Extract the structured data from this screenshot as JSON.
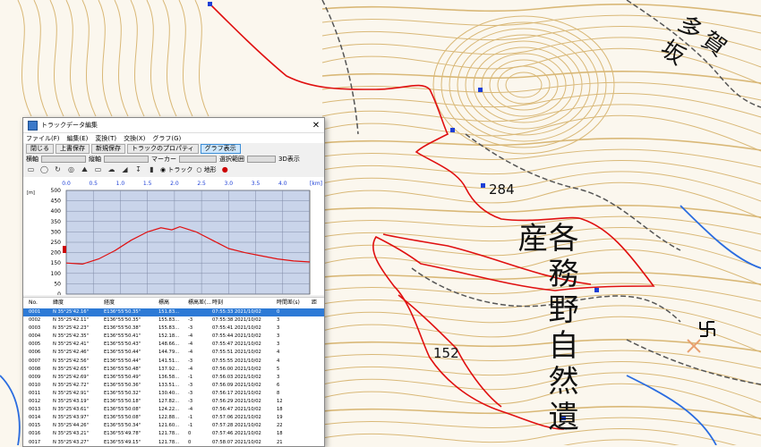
{
  "map": {
    "labels": {
      "place_top_right": "多賀坂",
      "place_vertical": "各務野自然遺産",
      "elev_284": "284",
      "elev_152": "152"
    },
    "colors": {
      "contour": "#d9b877",
      "track": "#e01010",
      "road": "#555555",
      "water": "#2a6ce0",
      "background": "#fbf7ee"
    }
  },
  "window": {
    "title": "トラックデータ編集",
    "close_label": "✕",
    "menu": [
      "ファイル(F)",
      "編集(E)",
      "変換(T)",
      "交換(X)",
      "グラフ(G)"
    ],
    "toolbar": {
      "close_btn": "閉じる",
      "overwrite_btn": "上書保存",
      "saveas_btn": "新規保存",
      "props_btn": "トラックのプロパティ",
      "graph_btn": "グラフ表示"
    },
    "controls": {
      "horizontal_label": "横軸",
      "vertical_label": "縦軸",
      "marker_label": "マーカー",
      "selection_label": "選択範囲",
      "view3d_label": "3D表示",
      "radio_track": "トラック",
      "radio_terrain": "地形"
    },
    "graph": {
      "x_unit": "[km]",
      "y_unit": "[m]",
      "x_ticks": [
        "0.0",
        "0.5",
        "1.0",
        "1.5",
        "2.0",
        "2.5",
        "3.0",
        "3.5",
        "4.0"
      ],
      "y_ticks": [
        "500",
        "450",
        "400",
        "350",
        "300",
        "250",
        "200",
        "150",
        "100",
        "50",
        "0"
      ]
    },
    "table": {
      "headers": [
        "No.",
        "緯度",
        "経度",
        "標高",
        "標高差(...",
        "時刻",
        "時間差(s)",
        "距"
      ],
      "rows": [
        [
          "0001",
          "N 35°25'42.16\"",
          "E136°55'50.35\"",
          "151.83...",
          "",
          "07:55:33 2021/10/02",
          "0",
          ""
        ],
        [
          "0002",
          "N 35°25'42.11\"",
          "E136°55'50.35\"",
          "155.83...",
          "-3",
          "07:55:38 2021/10/02",
          "3",
          ""
        ],
        [
          "0003",
          "N 35°25'42.23\"",
          "E136°55'50.38\"",
          "155.83...",
          "-3",
          "07:55:41 2021/10/02",
          "3",
          ""
        ],
        [
          "0004",
          "N 35°25'42.35\"",
          "E136°55'50.41\"",
          "152.18...",
          "-4",
          "07:55:44 2021/10/02",
          "3",
          ""
        ],
        [
          "0005",
          "N 35°25'42.41\"",
          "E136°55'50.43\"",
          "148.66...",
          "-4",
          "07:55:47 2021/10/02",
          "3",
          ""
        ],
        [
          "0006",
          "N 35°25'42.46\"",
          "E136°55'50.44\"",
          "144.79...",
          "-4",
          "07:55:51 2021/10/02",
          "4",
          ""
        ],
        [
          "0007",
          "N 35°25'42.56\"",
          "E136°55'50.44\"",
          "141.51...",
          "-3",
          "07:55:55 2021/10/02",
          "4",
          ""
        ],
        [
          "0008",
          "N 35°25'42.65\"",
          "E136°55'50.48\"",
          "137.92...",
          "-4",
          "07:56:00 2021/10/02",
          "5",
          ""
        ],
        [
          "0009",
          "N 35°25'42.69\"",
          "E136°55'50.49\"",
          "136.58...",
          "-1",
          "07:56:03 2021/10/02",
          "3",
          ""
        ],
        [
          "0010",
          "N 35°25'42.72\"",
          "E136°55'50.36\"",
          "133.51...",
          "-3",
          "07:56:09 2021/10/02",
          "6",
          ""
        ],
        [
          "0011",
          "N 35°25'42.91\"",
          "E136°55'50.32\"",
          "130.40...",
          "-3",
          "07:56:17 2021/10/02",
          "8",
          ""
        ],
        [
          "0012",
          "N 35°25'43.19\"",
          "E136°55'50.18\"",
          "127.82...",
          "-3",
          "07:56:29 2021/10/02",
          "12",
          ""
        ],
        [
          "0013",
          "N 35°25'43.61\"",
          "E136°55'50.08\"",
          "124.22...",
          "-4",
          "07:56:47 2021/10/02",
          "18",
          ""
        ],
        [
          "0014",
          "N 35°25'43.97\"",
          "E136°55'50.08\"",
          "122.88...",
          "-1",
          "07:57:06 2021/10/02",
          "19",
          ""
        ],
        [
          "0015",
          "N 35°25'44.26\"",
          "E136°55'50.34\"",
          "121.60...",
          "-1",
          "07:57:28 2021/10/02",
          "22",
          ""
        ],
        [
          "0016",
          "N 35°25'43.21\"",
          "E136°55'49.78\"",
          "121.78...",
          "0",
          "07:57:46 2021/10/02",
          "18",
          ""
        ],
        [
          "0017",
          "N 35°25'43.27\"",
          "E136°55'49.15\"",
          "121.78...",
          "0",
          "07:58:07 2021/10/02",
          "21",
          ""
        ]
      ]
    }
  }
}
